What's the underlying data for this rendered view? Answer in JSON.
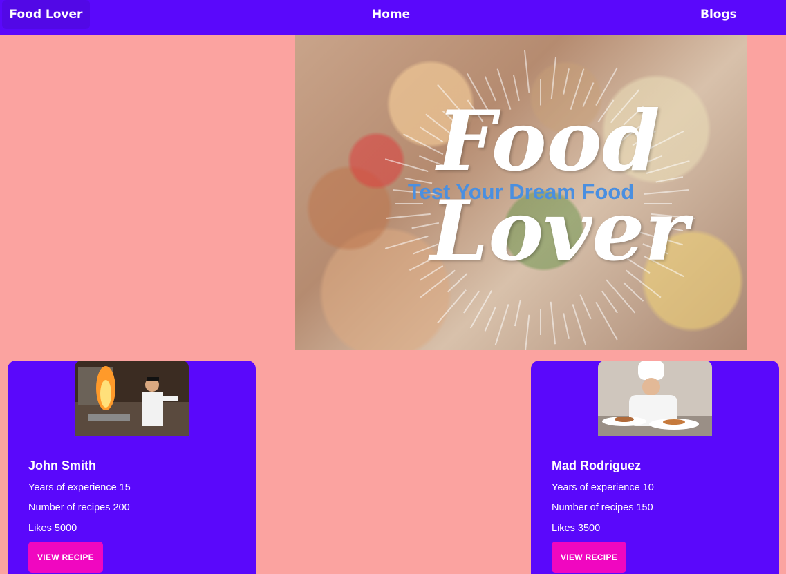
{
  "navbar": {
    "brand": "Food Lover",
    "links": [
      {
        "label": "Home"
      },
      {
        "label": "Blogs"
      }
    ]
  },
  "hero": {
    "logo_line1": "Food",
    "logo_line2": "Lover",
    "tagline": "Test Your Dream Food"
  },
  "chefs": [
    {
      "name": "John Smith",
      "experience": "Years of experience 15",
      "recipes": "Number of recipes 200",
      "likes": "Likes 5000",
      "button": "VIEW RECIPE"
    },
    {
      "name": "Mad Rodriguez",
      "experience": "Years of experience 10",
      "recipes": "Number of recipes 150",
      "likes": "Likes 3500",
      "button": "VIEW RECIPE"
    }
  ],
  "colors": {
    "page_bg": "#fba3a0",
    "nav_bg": "#5a08fb",
    "card_bg": "#5a08fb",
    "button_bg": "#f007c0",
    "tagline": "#4a8fe0"
  }
}
